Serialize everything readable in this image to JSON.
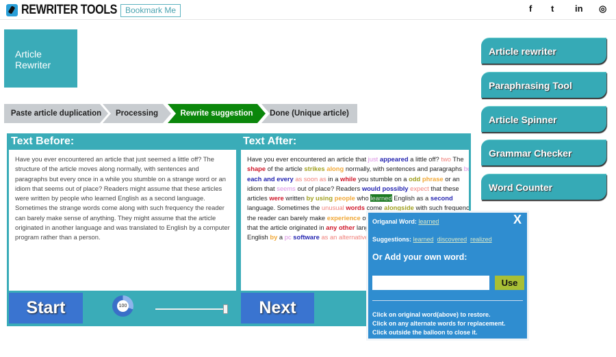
{
  "header": {
    "logo": "REWRITER TOOLS",
    "bookmark": "Bookmark Me",
    "social": [
      {
        "icon": "facebook-icon",
        "glyph": "f"
      },
      {
        "icon": "twitter-icon",
        "glyph": "t"
      },
      {
        "icon": "linkedin-icon",
        "glyph": "in"
      },
      {
        "icon": "instagram-icon",
        "glyph": "◎"
      }
    ]
  },
  "title_box": {
    "line1": "Article",
    "line2": "Rewriter"
  },
  "steps": [
    {
      "label": "Paste article duplication",
      "active": false
    },
    {
      "label": "Processing",
      "active": false
    },
    {
      "label": "Rewrite suggestion",
      "active": true
    },
    {
      "label": "Done (Unique article)",
      "active": false
    }
  ],
  "panel": {
    "before_title": "Text Before:",
    "after_title": "Text After:",
    "before_text": "Have you ever encountered an article that just seemed a little off?  The structure of the article moves along normally, with sentences and paragraphs but every once in a while you stumble on a strange word or an idiom that seems out of place? Readers might assume that these articles were written by people who learned English as a second language. Sometimes the strange words come along with such frequency the reader can barely make sense of anything.  They might assume that the article originated in another language and was translated to English by a computer program rather than a person.",
    "after_lines": [
      [
        [
          "",
          "Have you ever encountered an article that "
        ],
        [
          "p",
          "just"
        ],
        [
          "",
          " "
        ],
        [
          "b",
          "appeared"
        ],
        [
          "",
          " a little off? "
        ],
        [
          "s",
          "two"
        ],
        [
          "",
          " The"
        ]
      ],
      [
        [
          "r",
          "shape"
        ],
        [
          "",
          " of the article "
        ],
        [
          "o",
          "strikes"
        ],
        [
          "",
          " "
        ],
        [
          "y",
          "along"
        ],
        [
          "",
          " normally, with sentences and paragraphs "
        ],
        [
          "p",
          "but"
        ]
      ],
      [
        [
          "b",
          "each and every"
        ],
        [
          "",
          " "
        ],
        [
          "s",
          "as soon as"
        ],
        [
          "",
          " in a "
        ],
        [
          "r",
          "while"
        ],
        [
          "",
          " you stumble on a "
        ],
        [
          "o",
          "odd"
        ],
        [
          "",
          " "
        ],
        [
          "y",
          "phrase"
        ],
        [
          "",
          " or an"
        ]
      ],
      [
        [
          "",
          "idiom that "
        ],
        [
          "p",
          "seems"
        ],
        [
          "",
          " out of place? Readers "
        ],
        [
          "b",
          "would possibly"
        ],
        [
          "",
          " "
        ],
        [
          "s",
          "expect"
        ],
        [
          "",
          " that these"
        ]
      ],
      [
        [
          "",
          "articles "
        ],
        [
          "r",
          "were"
        ],
        [
          "",
          " written "
        ],
        [
          "o",
          "by using"
        ],
        [
          "",
          " "
        ],
        [
          "y",
          "people"
        ],
        [
          "",
          " who "
        ],
        [
          "h",
          "learned"
        ],
        [
          "",
          " English as a "
        ],
        [
          "b",
          "second"
        ]
      ],
      [
        [
          "",
          "language. Sometimes the "
        ],
        [
          "s",
          "unusual"
        ],
        [
          "",
          " "
        ],
        [
          "r",
          "words"
        ],
        [
          "",
          " come "
        ],
        [
          "o",
          "alongside"
        ],
        [
          "",
          " with such frequency"
        ]
      ],
      [
        [
          "",
          "the reader can barely make "
        ],
        [
          "y",
          "experience"
        ],
        [
          "",
          " of a"
        ]
      ],
      [
        [
          "",
          "that the article originated in "
        ],
        [
          "r",
          "any other"
        ],
        [
          "",
          " lang"
        ]
      ],
      [
        [
          "",
          "English "
        ],
        [
          "y",
          "by"
        ],
        [
          "",
          " a "
        ],
        [
          "p",
          "pc"
        ],
        [
          "",
          " "
        ],
        [
          "b",
          "software"
        ],
        [
          "",
          " "
        ],
        [
          "s",
          "as an alternative"
        ],
        [
          "",
          " t"
        ]
      ]
    ],
    "start": "Start",
    "next": "Next",
    "dial_value": "100",
    "slider_percent": 100
  },
  "popup": {
    "original_label": "Origanal Word:",
    "original_word": "learned",
    "suggestions_label": "Suggestions:",
    "suggestions": [
      "learned",
      "discovered",
      "realized"
    ],
    "add_label": "Or Add your own word:",
    "input_value": "",
    "use": "Use",
    "close": "X",
    "help": [
      "Click on original word(above) to restore.",
      "Click on any alternate words for replacement.",
      "Click outside the balloon to close it."
    ]
  },
  "sidebar": [
    "Article rewriter",
    "Paraphrasing Tool",
    "Article Spinner",
    "Grammar Checker",
    "Word Counter"
  ],
  "colors": {
    "teal": "#3aacb8",
    "green_step": "#0b870b",
    "button_blue": "#3a74d0",
    "popup_blue": "#2f8dd0",
    "use_green": "#a8bf35"
  }
}
